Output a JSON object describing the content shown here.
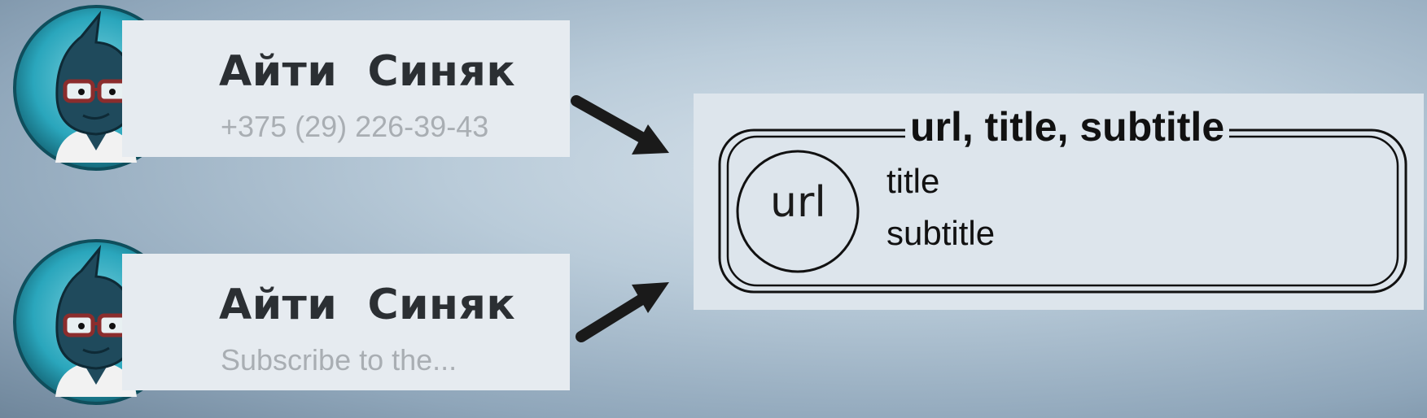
{
  "cards": [
    {
      "name": "Айти  Синяк",
      "subtitle": "+375 (29) 226-39-43"
    },
    {
      "name": "Айти  Синяк",
      "subtitle": "Subscribe to the..."
    }
  ],
  "panel": {
    "heading": "url, title, subtitle",
    "avatar_text": "url",
    "title_text": "title",
    "subtitle_text": "subtitle"
  },
  "colors": {
    "card_bg": "#e6ebf0",
    "name_text": "#2b2f33",
    "subtitle_text": "#a9aeb3",
    "avatar_ring": "#2aa6bc",
    "avatar_skin": "#1f4a5c",
    "arrow": "#1a1a1a"
  },
  "icons": {
    "avatar": "cartoon-avatar-with-glasses",
    "arrows": "arrow-right"
  }
}
